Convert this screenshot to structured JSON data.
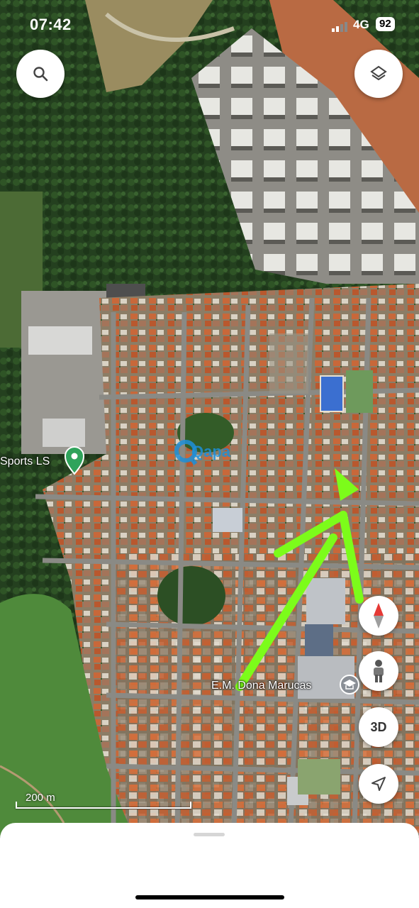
{
  "status_bar": {
    "time": "07:42",
    "network": "4G",
    "battery": "92"
  },
  "map": {
    "labels": {
      "sports_poi": "Sports LS",
      "school_poi": "E.M. Dona Marucas",
      "watermark": "Qapa"
    },
    "scale_text": "200 m"
  },
  "controls": {
    "search_icon": "search-icon",
    "layers_icon": "layers-icon",
    "compass_icon": "compass-icon",
    "pegman_icon": "pegman-icon",
    "three_d_label": "3D",
    "locate_icon": "location-arrow-icon"
  },
  "colors": {
    "annotation_arrow": "#7CFC1A",
    "poi_pin": "#2fa35b",
    "compass_red": "#e53935"
  }
}
